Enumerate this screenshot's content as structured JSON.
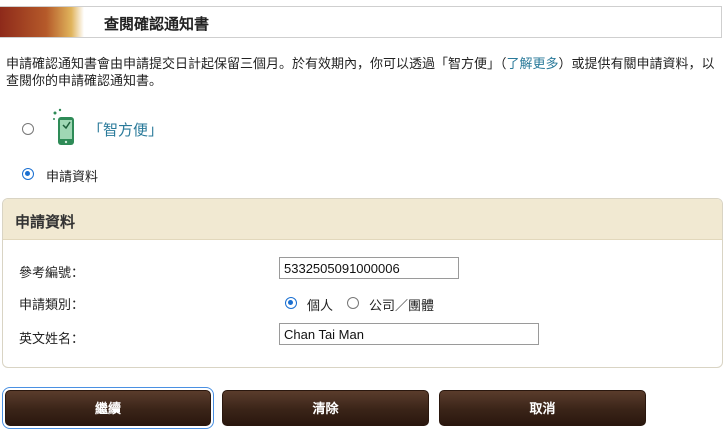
{
  "header": {
    "title": "查閱確認通知書"
  },
  "intro": {
    "text_before": "申請確認通知書會由申請提交日計起保留三個月。於有效期內，你可以透過「智方便」（",
    "link": "了解更多",
    "text_after": "）或提供有關申請資料，以查閱你的申請確認通知書。"
  },
  "method_options": [
    {
      "label": "「智方便」",
      "selected": false,
      "icon": "iamsmart-phone-icon"
    },
    {
      "label": "申請資料",
      "selected": true
    }
  ],
  "form": {
    "panel_title": "申請資料",
    "reference_label": "參考編號：",
    "reference_value": "5332505091000006",
    "category_label": "申請類別：",
    "category_options": [
      {
        "label": "個人",
        "selected": true
      },
      {
        "label": "公司／團體",
        "selected": false
      }
    ],
    "name_label": "英文姓名：",
    "name_value": "Chan Tai Man"
  },
  "buttons": {
    "continue": "繼續",
    "clear": "清除",
    "cancel": "取消"
  },
  "colors": {
    "accent": "#8e2a1a",
    "link": "#2a7a9a",
    "panel_header": "#f1e9d2",
    "button": "#3a2418",
    "radio": "#1a6fd1"
  }
}
